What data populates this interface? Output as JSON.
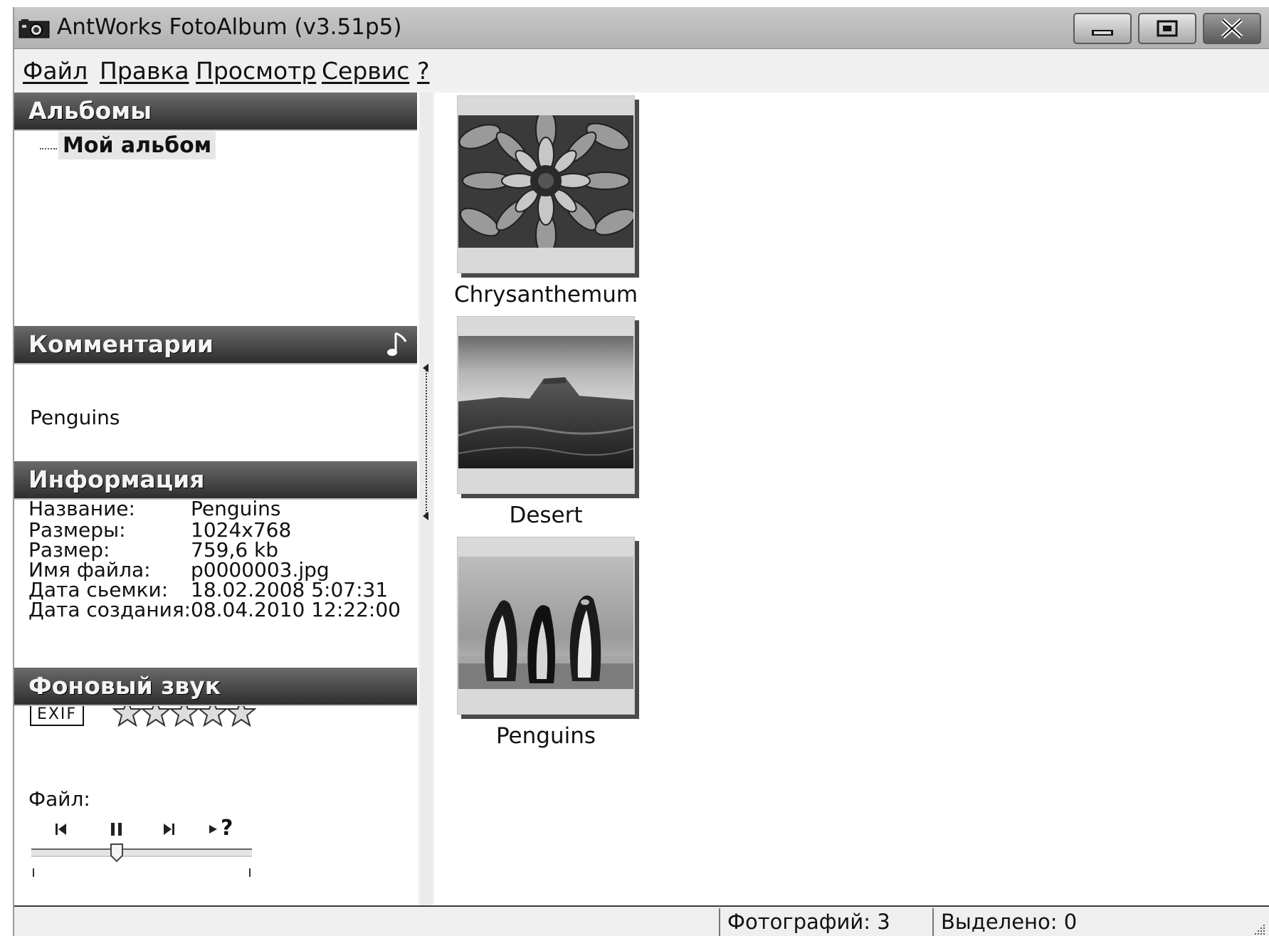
{
  "window": {
    "title": "AntWorks FotoAlbum (v3.51p5)"
  },
  "menu": {
    "items": [
      "Файл",
      "Правка",
      "Просмотр",
      "Сервис",
      "?"
    ]
  },
  "albums": {
    "header": "Альбомы",
    "items": [
      "Мой альбом"
    ]
  },
  "comments": {
    "header": "Комментарии",
    "text": "Penguins",
    "icon": "music-note-icon"
  },
  "info": {
    "header": "Информация",
    "rows": [
      {
        "label": "Название:",
        "value": "Penguins"
      },
      {
        "label": "Размеры:",
        "value": "1024x768"
      },
      {
        "label": "Размер:",
        "value": "759,6 kb"
      },
      {
        "label": "Имя файла:",
        "value": "p0000003.jpg"
      },
      {
        "label": "Дата сьемки:",
        "value": "18.02.2008 5:07:31"
      },
      {
        "label": "Дата создания:",
        "value": "08.04.2010 12:22:00"
      }
    ],
    "exif_label": "EXIF",
    "rating": {
      "value": 0,
      "max": 5
    }
  },
  "sound": {
    "header": "Фоновый звук",
    "file_label": "Файл:",
    "controls": [
      "prev-track-icon",
      "pause-icon",
      "next-track-icon",
      "play-random-icon"
    ],
    "random_label": "?"
  },
  "thumbnails": [
    {
      "caption": "Chrysanthemum"
    },
    {
      "caption": "Desert"
    },
    {
      "caption": "Penguins"
    }
  ],
  "status": {
    "photos": "Фотографий: 3",
    "selected": "Выделено: 0"
  }
}
